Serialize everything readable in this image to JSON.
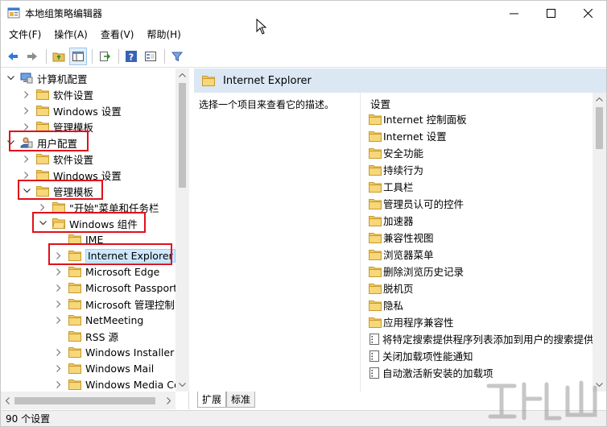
{
  "window": {
    "title": "本地组策略编辑器"
  },
  "menubar": [
    {
      "label": "文件(F)"
    },
    {
      "label": "操作(A)"
    },
    {
      "label": "查看(V)"
    },
    {
      "label": "帮助(H)"
    }
  ],
  "toolbar": {
    "buttons": [
      "back-arrow-icon",
      "forward-arrow-icon",
      "up-folder-icon",
      "show-hide-tree-icon",
      "export-list-icon",
      "help-icon",
      "console-tree-icon",
      "filter-icon"
    ]
  },
  "tree": {
    "items": [
      {
        "label": "计算机配置"
      },
      {
        "label": "软件设置"
      },
      {
        "label": "Windows 设置"
      },
      {
        "label": "管理模板"
      },
      {
        "label": "用户配置"
      },
      {
        "label": "软件设置"
      },
      {
        "label": "Windows 设置"
      },
      {
        "label": "管理模板"
      },
      {
        "label": "\"开始\"菜单和任务栏"
      },
      {
        "label": "Windows 组件"
      },
      {
        "label": "IME"
      },
      {
        "label": "Internet Explorer"
      },
      {
        "label": "Microsoft Edge"
      },
      {
        "label": "Microsoft Passport"
      },
      {
        "label": "Microsoft 管理控制台"
      },
      {
        "label": "NetMeeting"
      },
      {
        "label": "RSS 源"
      },
      {
        "label": "Windows Installer"
      },
      {
        "label": "Windows Mail"
      },
      {
        "label": "Windows Media Center"
      }
    ]
  },
  "right": {
    "header": "Internet Explorer",
    "description": "选择一个项目来查看它的描述。",
    "column_heading": "设置",
    "items": [
      {
        "label": "Internet 控制面板",
        "kind": "folder"
      },
      {
        "label": "Internet 设置",
        "kind": "folder"
      },
      {
        "label": "安全功能",
        "kind": "folder"
      },
      {
        "label": "持续行为",
        "kind": "folder"
      },
      {
        "label": "工具栏",
        "kind": "folder"
      },
      {
        "label": "管理员认可的控件",
        "kind": "folder"
      },
      {
        "label": "加速器",
        "kind": "folder"
      },
      {
        "label": "兼容性视图",
        "kind": "folder"
      },
      {
        "label": "浏览器菜单",
        "kind": "folder"
      },
      {
        "label": "删除浏览历史记录",
        "kind": "folder"
      },
      {
        "label": "脱机页",
        "kind": "folder"
      },
      {
        "label": "隐私",
        "kind": "folder"
      },
      {
        "label": "应用程序兼容性",
        "kind": "folder"
      },
      {
        "label": "将特定搜索提供程序列表添加到用户的搜索提供程序",
        "kind": "policy"
      },
      {
        "label": "关闭加载项性能通知",
        "kind": "policy"
      },
      {
        "label": "自动激活新安装的加载项",
        "kind": "policy"
      }
    ],
    "tabs": [
      {
        "label": "扩展"
      },
      {
        "label": "标准"
      }
    ]
  },
  "statusbar": {
    "text": "90 个设置"
  }
}
